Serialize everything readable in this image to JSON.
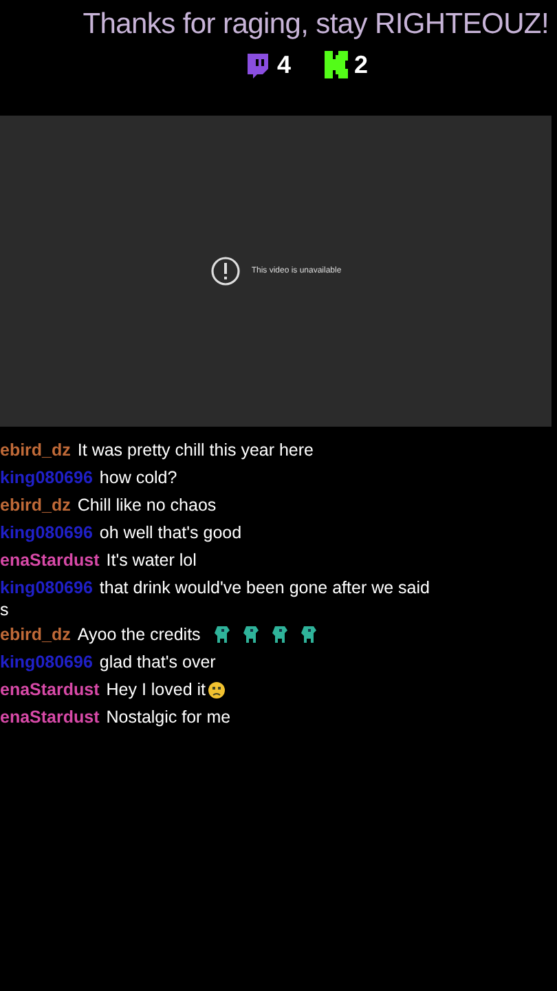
{
  "banner": {
    "title": "Thanks for raging, stay RIGHTEOUZ!"
  },
  "counters": [
    {
      "kind": "twitch",
      "count": "4"
    },
    {
      "kind": "kick",
      "count": "2"
    }
  ],
  "video": {
    "message": "This video is unavailable"
  },
  "chat": [
    {
      "user": "ebird_dz",
      "color": "#c06a38",
      "text": "It was pretty chill this year here"
    },
    {
      "user": "king080696",
      "color": "#2020c8",
      "text": "how cold?"
    },
    {
      "user": "ebird_dz",
      "color": "#c06a38",
      "text": "Chill like no chaos"
    },
    {
      "user": "king080696",
      "color": "#2020c8",
      "text": "oh well that's good"
    },
    {
      "user": "enaStardust",
      "color": "#d84aa8",
      "text": "It's water lol"
    },
    {
      "user": "king080696",
      "color": "#2020c8",
      "text": "that drink would've been gone after we said",
      "wrap": "s"
    },
    {
      "user": "ebird_dz",
      "color": "#c06a38",
      "text": "Ayoo the credits",
      "emotes": [
        {
          "kind": "dinosaur"
        },
        {
          "kind": "dinosaur"
        },
        {
          "kind": "dinosaur"
        },
        {
          "kind": "dinosaur"
        }
      ]
    },
    {
      "user": "king080696",
      "color": "#2020c8",
      "text": "glad that's over"
    },
    {
      "user": "enaStardust",
      "color": "#d84aa8",
      "text": "Hey I loved it",
      "emotes": [
        {
          "kind": "sad-face"
        }
      ]
    },
    {
      "user": "enaStardust",
      "color": "#d84aa8",
      "text": "Nostalgic for me"
    }
  ]
}
